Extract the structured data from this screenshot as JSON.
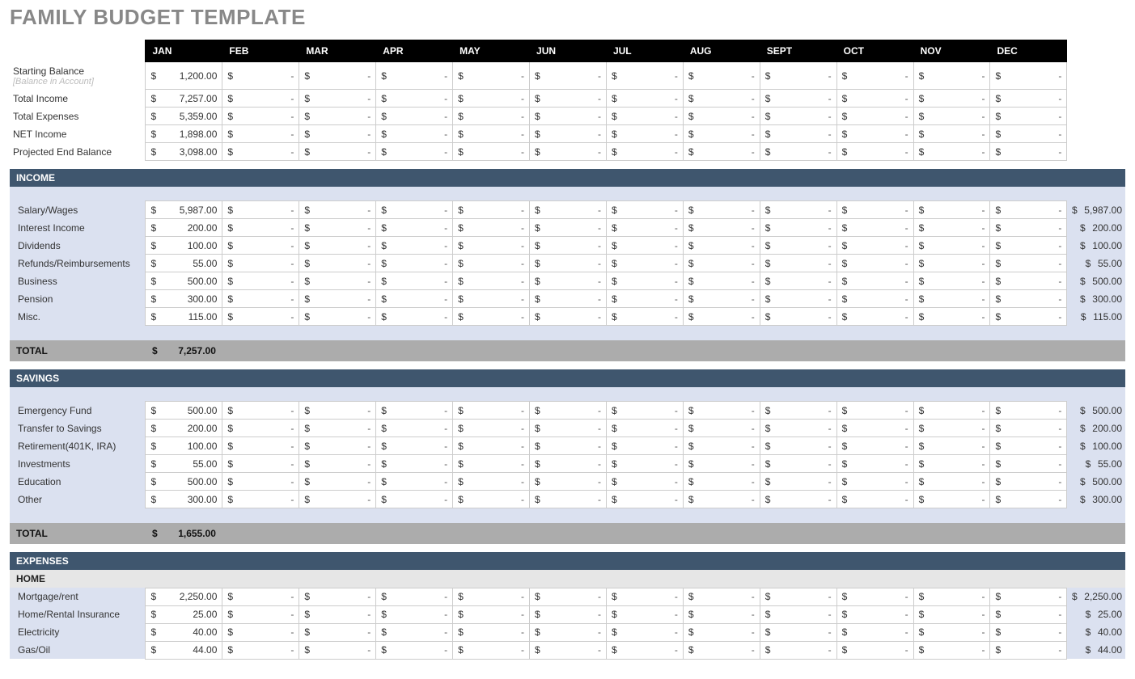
{
  "title": "FAMILY BUDGET TEMPLATE",
  "months": [
    "JAN",
    "FEB",
    "MAR",
    "APR",
    "MAY",
    "JUN",
    "JUL",
    "AUG",
    "SEPT",
    "OCT",
    "NOV",
    "DEC"
  ],
  "summary": [
    {
      "label": "Starting Balance",
      "sublabel": "[Balance in Account]",
      "jan": "1,200.00"
    },
    {
      "label": "Total Income",
      "jan": "7,257.00"
    },
    {
      "label": "Total Expenses",
      "jan": "5,359.00"
    },
    {
      "label": "NET Income",
      "jan": "1,898.00"
    },
    {
      "label": "Projected End Balance",
      "jan": "3,098.00"
    }
  ],
  "sections": [
    {
      "id": "income",
      "title": "INCOME",
      "subheader": null,
      "rows": [
        {
          "label": "Salary/Wages",
          "jan": "5,987.00",
          "total": "5,987.00"
        },
        {
          "label": "Interest Income",
          "jan": "200.00",
          "total": "200.00"
        },
        {
          "label": "Dividends",
          "jan": "100.00",
          "total": "100.00"
        },
        {
          "label": "Refunds/Reimbursements",
          "jan": "55.00",
          "total": "55.00"
        },
        {
          "label": "Business",
          "jan": "500.00",
          "total": "500.00"
        },
        {
          "label": "Pension",
          "jan": "300.00",
          "total": "300.00"
        },
        {
          "label": "Misc.",
          "jan": "115.00",
          "total": "115.00"
        }
      ],
      "total_label": "TOTAL",
      "total_value": "7,257.00"
    },
    {
      "id": "savings",
      "title": "SAVINGS",
      "subheader": null,
      "rows": [
        {
          "label": "Emergency Fund",
          "jan": "500.00",
          "total": "500.00"
        },
        {
          "label": "Transfer to Savings",
          "jan": "200.00",
          "total": "200.00"
        },
        {
          "label": "Retirement(401K, IRA)",
          "jan": "100.00",
          "total": "100.00"
        },
        {
          "label": "Investments",
          "jan": "55.00",
          "total": "55.00"
        },
        {
          "label": "Education",
          "jan": "500.00",
          "total": "500.00"
        },
        {
          "label": "Other",
          "jan": "300.00",
          "total": "300.00"
        }
      ],
      "total_label": "TOTAL",
      "total_value": "1,655.00"
    },
    {
      "id": "expenses",
      "title": "EXPENSES",
      "subheader": "HOME",
      "rows": [
        {
          "label": "Mortgage/rent",
          "jan": "2,250.00",
          "total": "2,250.00"
        },
        {
          "label": "Home/Rental Insurance",
          "jan": "25.00",
          "total": "25.00"
        },
        {
          "label": "Electricity",
          "jan": "40.00",
          "total": "40.00"
        },
        {
          "label": "Gas/Oil",
          "jan": "44.00",
          "total": "44.00"
        }
      ],
      "total_label": null,
      "total_value": null
    }
  ],
  "currency": "$",
  "dash": "-"
}
